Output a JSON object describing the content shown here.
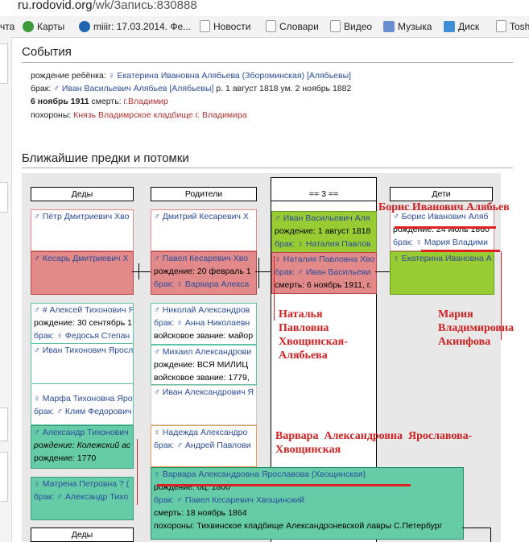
{
  "browser": {
    "url_host": "ru.rodovid.org",
    "url_path": "/wk/Запись:830888",
    "bookmarks": [
      {
        "label": "чта",
        "icon": "mail-icon"
      },
      {
        "label": "Карты",
        "icon": "maps-icon"
      },
      {
        "label": "miiir: 17.03.2014. Фе...",
        "icon": "user-icon"
      },
      {
        "label": "Новости",
        "icon": "page-icon"
      },
      {
        "label": "Словари",
        "icon": "page-icon"
      },
      {
        "label": "Видео",
        "icon": "video-icon"
      },
      {
        "label": "Музыка",
        "icon": "music-icon"
      },
      {
        "label": "Диск",
        "icon": "disk-icon"
      },
      {
        "label": "Tosh",
        "icon": "page-icon"
      }
    ]
  },
  "events": {
    "title": "События",
    "rows": [
      {
        "k": "рождение ребёнка: ",
        "v": "♀ Екатерина Ивановна Алябьева (Збороминская) [Алябьевы]"
      },
      {
        "k": "брак: ",
        "v": "♂ Иван Васильевич Алябьев [Алябьевы]",
        "tail": " р. 1 август 1818 ум. 2 ноябрь 1882"
      },
      {
        "date": "6 ноябрь 1911",
        "k": " смерть: ",
        "v": "г.Владимир"
      },
      {
        "k": "похороны: ",
        "v": "Князь Владимрское кладбище г. Владимира"
      }
    ]
  },
  "tree": {
    "title": "Ближайшие предки и потомки",
    "columns": [
      "Деды",
      "Родители",
      "== 3 ==",
      "Дети"
    ],
    "bottom_column": "Деды",
    "grandparents": [
      {
        "style": "pink",
        "rows": [
          "♂ Пётр Дмитриевич Хво"
        ]
      },
      {
        "style": "rose",
        "rows": [
          "♂ Кесарь Дмитриевич Х"
        ]
      },
      {
        "style": "teal",
        "rows": [
          "♂ # Алексей Тихонович Я",
          "рождение: 30 сентябрь 1",
          "брак: ♀ Федосья Степан"
        ]
      },
      {
        "style": "teal",
        "rows": [
          "♂ Иван Тихонович Яросл"
        ]
      },
      {
        "style": "teal",
        "rows": [
          "♀ Марфа Тихоновна Яро",
          "брак: ♂ Клим Федорович"
        ]
      },
      {
        "style": "green",
        "rows": [
          "♂ Александр Тихонович",
          "рождение: Колежский ас",
          "рождение: 1770"
        ]
      },
      {
        "style": "green",
        "rows": [
          "♀ Матрена Петровна ? (",
          "брак: ♂ Александр Тихо"
        ]
      }
    ],
    "parents": [
      {
        "style": "pink",
        "rows": [
          "♂ Дмитрий Кесаревич Х"
        ]
      },
      {
        "style": "rose",
        "rows": [
          "♂ Павел Кесаревич Хво",
          "рождение: 20 февраль 1",
          "брак: ♀ Варвара Алекса"
        ]
      },
      {
        "style": "teal",
        "rows": [
          "♂ Николай Александров",
          "брак: ♀ Анна Николаевн",
          "войсковое звание: майор"
        ]
      },
      {
        "style": "teal",
        "rows": [
          "♂ Михаил Александрови",
          "рождение: ВСЯ МИЛИЦ",
          "войсковое звание: 1779,"
        ]
      },
      {
        "style": "white",
        "rows": [
          "♂ Иван Александрович Я"
        ]
      },
      {
        "style": "yellowb",
        "rows": [
          "♀ Надежда Александро",
          "брак: ♂ Андрей Павлови"
        ]
      }
    ],
    "self": [
      {
        "style": "lime",
        "rows": [
          "♂ Иван Васильевич Аля",
          "рождение: 1 август 1818",
          "брак: ♀ Наталия Павлов"
        ]
      },
      {
        "style": "rose",
        "rows": [
          "♀ Наталия Павловна Хво",
          "брак: ♂ Иван Васильеви",
          "смерть: 6 ноябрь 1911, г."
        ]
      }
    ],
    "children": [
      {
        "style": "pink",
        "rows": [
          "♂ Борис Иванович Аляб",
          "рождение: 24 июль 1860",
          "брак: ♀ Мария Владими"
        ]
      },
      {
        "style": "lime",
        "rows": [
          "♀ Екатерина Ивановна А"
        ]
      }
    ],
    "popup": {
      "rows": [
        "♀ Варвара Александровна Ярославова (Хвощинская)",
        "рождение: оц. 1800",
        "брак: ♂ Павел Кесаревич Хвощинский",
        "смерть: 18 ноябрь 1864",
        "похороны: Тихвинское кладбище Александроневской лавры С.Петербург"
      ]
    }
  },
  "annotations": {
    "boris": "Борис Иванович Алябьев",
    "natalia": [
      "Наталья",
      "Павловна",
      "Хвощинская-",
      "Алябьева"
    ],
    "maria": [
      "Мария",
      "Владимировна",
      "Акинфова"
    ],
    "varvara": [
      "Варвара  Александровна  Ярославова-",
      "Хвощинская"
    ]
  }
}
